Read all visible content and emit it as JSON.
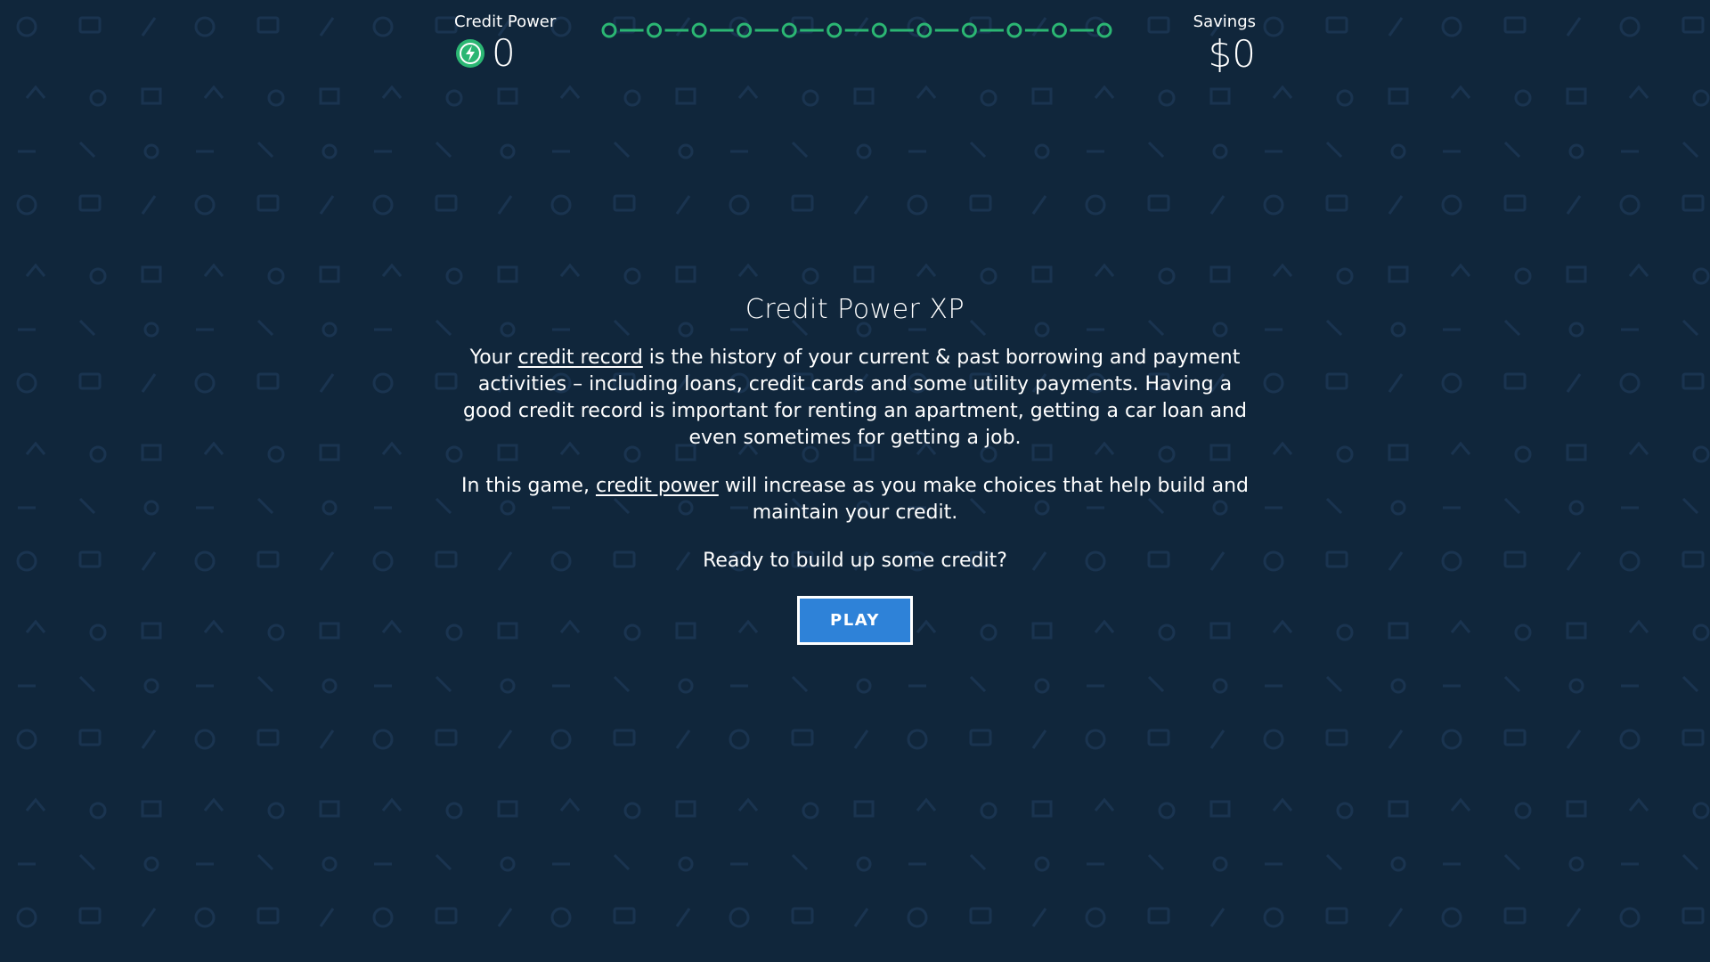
{
  "hud": {
    "credit_label": "Credit Power",
    "credit_value": "0",
    "credit_icon": "lightning-bolt-icon",
    "savings_label": "Savings",
    "savings_value": "$0",
    "progress": {
      "total_steps": 12,
      "completed_steps": 0
    }
  },
  "intro": {
    "title": "Credit Power XP",
    "p1_before": "Your ",
    "p1_link": "credit record",
    "p1_after": " is the history of your current & past borrowing and payment activities – including loans, credit cards and some utility payments. Having a good credit record is important for renting an apartment, getting a car loan and even sometimes for getting a job.",
    "p2_before": "In this game, ",
    "p2_link": "credit power",
    "p2_after": " will increase as you make choices that help build and maintain your credit.",
    "p3": "Ready to build up some credit?",
    "play_label": "PLAY"
  },
  "colors": {
    "background": "#10263b",
    "pattern": "#16304a",
    "accent_green": "#2bb673",
    "play_blue": "#2e82d8",
    "text": "#ffffff"
  }
}
